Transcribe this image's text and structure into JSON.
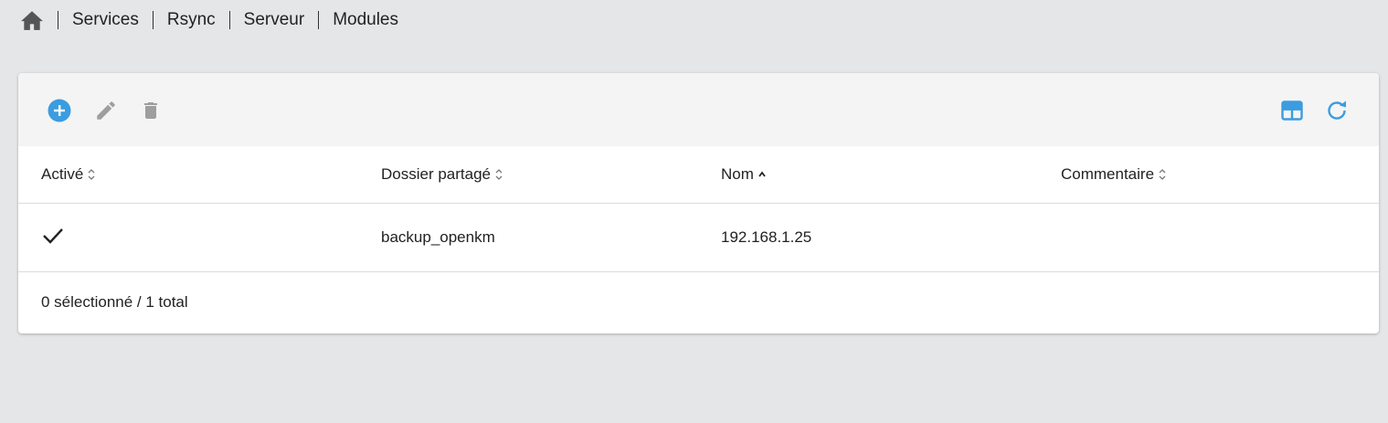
{
  "breadcrumb": {
    "items": [
      "Services",
      "Rsync",
      "Serveur",
      "Modules"
    ]
  },
  "toolbar": {
    "icons": [
      "add-circle-icon",
      "edit-pencil-icon",
      "delete-trash-icon",
      "table-columns-icon",
      "refresh-icon"
    ],
    "accent_color": "#3b9ce0",
    "disabled_color": "#9e9e9e"
  },
  "table": {
    "columns": [
      "Activé",
      "Dossier partagé",
      "Nom",
      "Commentaire"
    ],
    "sort": {
      "column": "Nom",
      "direction": "ascending"
    },
    "rows": [
      {
        "active": true,
        "shared_folder": "backup_openkm",
        "name": "192.168.1.25",
        "comment": ""
      }
    ]
  },
  "footer": {
    "summary": "0 sélectionné / 1 total"
  }
}
